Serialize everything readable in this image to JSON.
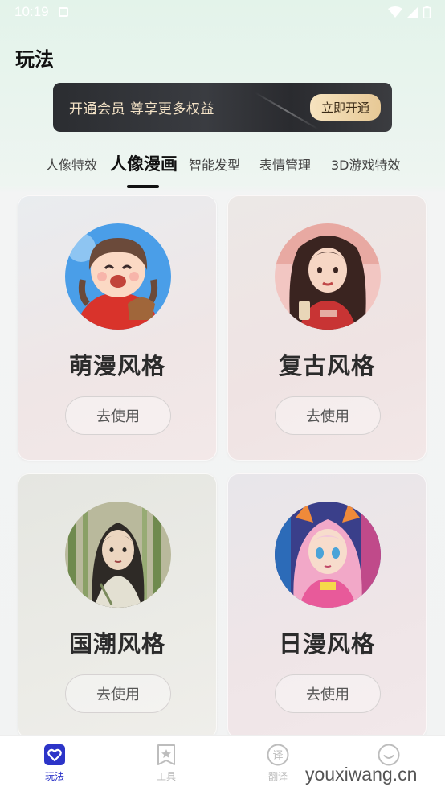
{
  "status_bar": {
    "time": "10:19"
  },
  "page_title": "玩法",
  "vip_banner": {
    "text": "开通会员 尊享更多权益",
    "button": "立即开通"
  },
  "tabs": [
    {
      "label": "人像特效"
    },
    {
      "label": "人像漫画",
      "active": true
    },
    {
      "label": "智能发型"
    },
    {
      "label": "表情管理"
    },
    {
      "label": "3D游戏特效"
    }
  ],
  "cards": [
    {
      "title": "萌漫风格",
      "button": "去使用",
      "avatar_icon": "cute-girl-avatar"
    },
    {
      "title": "复古风格",
      "button": "去使用",
      "avatar_icon": "retro-girl-avatar"
    },
    {
      "title": "国潮风格",
      "button": "去使用",
      "avatar_icon": "guochao-girl-avatar"
    },
    {
      "title": "日漫风格",
      "button": "去使用",
      "avatar_icon": "anime-girl-avatar"
    }
  ],
  "bottom_nav": [
    {
      "label": "玩法",
      "icon": "heart-icon",
      "active": true
    },
    {
      "label": "工具",
      "icon": "star-bookmark-icon"
    },
    {
      "label": "翻译",
      "icon": "translate-icon"
    },
    {
      "label": "",
      "icon": "smile-icon"
    }
  ],
  "watermark": "youxiwang.cn",
  "colors": {
    "accent": "#2c34c8",
    "vip_gold": "#f3e2c6"
  }
}
